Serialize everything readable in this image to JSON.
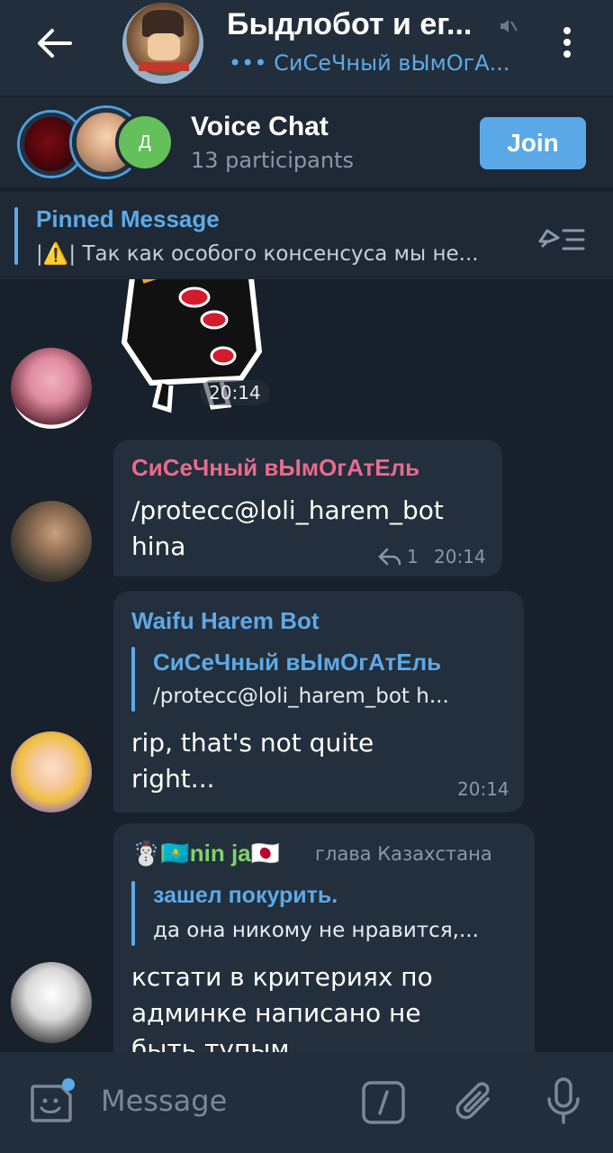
{
  "header": {
    "title": "Быдлобот и ег...",
    "status": "••• СиСеЧный вЫмОгА...",
    "back_icon": "arrow-left-icon",
    "mute_icon": "speaker-muted-icon",
    "menu_icon": "more-vertical-icon"
  },
  "voice_chat": {
    "title": "Voice Chat",
    "participants": "13 participants",
    "join_label": "Join",
    "third_avatar_letter": "Д"
  },
  "pinned": {
    "title": "Pinned Message",
    "text": "|⚠️| Так как особого консенсуса мы не...",
    "icon": "unpin-list-icon"
  },
  "messages": [
    {
      "type": "sticker",
      "time": "20:14"
    },
    {
      "sender": "СиСеЧный вЫмОгАтЕль",
      "lines": [
        "/protecc@loli_harem_bot",
        "hina"
      ],
      "reply_count": "1",
      "time": "20:14"
    },
    {
      "sender": "Waifu Harem Bot",
      "reply_to_name": "СиСеЧный вЫмОгАтЕль",
      "reply_to_text": "/protecc@loli_harem_bot h...",
      "lines": [
        "rip, that's not quite",
        "right..."
      ],
      "time": "20:14"
    },
    {
      "sender": "☃️🇰🇿nin ja🇯🇵",
      "sender_title": "глава Казахстана",
      "reply_to_name": "зашел покурить.",
      "reply_to_text": "да она никому не нравится,...",
      "lines": [
        "кстати в критериях по",
        "админке написано не",
        "быть тупым"
      ]
    }
  ],
  "composer": {
    "placeholder": "Message",
    "emoji_icon": "sticker-emoji-icon",
    "command_icon": "bot-command-icon",
    "attach_icon": "paperclip-icon",
    "mic_icon": "microphone-icon"
  },
  "colors": {
    "background": "#17202b",
    "header": "#222e3b",
    "bubble": "#232f3c",
    "accent": "#5ea9e6",
    "sender_pink": "#e86b8d",
    "sender_blue": "#5ea9e6",
    "sender_green": "#7ed36b"
  }
}
